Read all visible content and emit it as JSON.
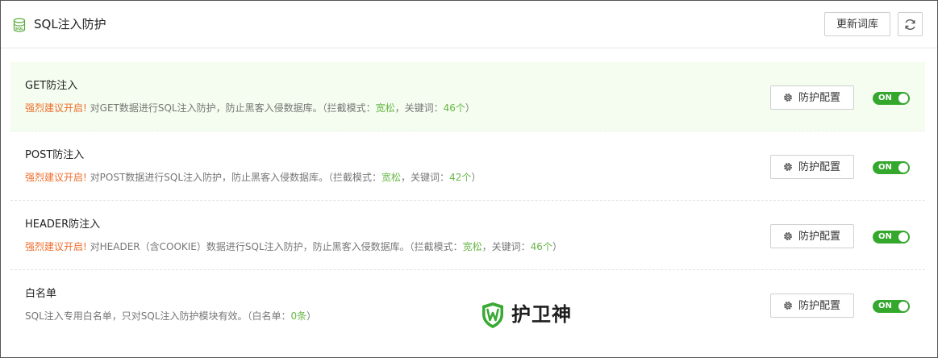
{
  "header": {
    "title": "SQL注入防护",
    "update_button": "更新词库",
    "db_icon": "database-sql-icon",
    "refresh_icon": "refresh-icon"
  },
  "rows": [
    {
      "title": "GET防注入",
      "warn": "强烈建议开启!",
      "desc_pre": "对GET数据进行SQL注入防护，防止黑客入侵数据库。（拦截模式：",
      "mode": "宽松",
      "desc_mid": "，关键词：",
      "keywords": "46个",
      "desc_post": "）",
      "config_label": "防护配置",
      "toggle_label": "ON",
      "highlighted": true
    },
    {
      "title": "POST防注入",
      "warn": "强烈建议开启!",
      "desc_pre": "对POST数据进行SQL注入防护，防止黑客入侵数据库。（拦截模式：",
      "mode": "宽松",
      "desc_mid": "，关键词：",
      "keywords": "42个",
      "desc_post": "）",
      "config_label": "防护配置",
      "toggle_label": "ON",
      "highlighted": false
    },
    {
      "title": "HEADER防注入",
      "warn": "强烈建议开启!",
      "desc_pre": "对HEADER（含COOKIE）数据进行SQL注入防护，防止黑客入侵数据库。（拦截模式：",
      "mode": "宽松",
      "desc_mid": "，关键词：",
      "keywords": "46个",
      "desc_post": "）",
      "config_label": "防护配置",
      "toggle_label": "ON",
      "highlighted": false
    },
    {
      "title": "白名单",
      "desc_pre": "SQL注入专用白名单，只对SQL注入防护模块有效。（白名单：",
      "count": "0条",
      "desc_post": "）",
      "config_label": "防护配置",
      "toggle_label": "ON",
      "highlighted": false
    }
  ],
  "watermark": {
    "text": "护卫神",
    "logo_icon": "shield-w-logo-icon"
  },
  "colors": {
    "warning": "#ef6d2c",
    "accent_green": "#67b746",
    "toggle_on": "#34a82d",
    "highlight_bg": "#f4fdef"
  }
}
